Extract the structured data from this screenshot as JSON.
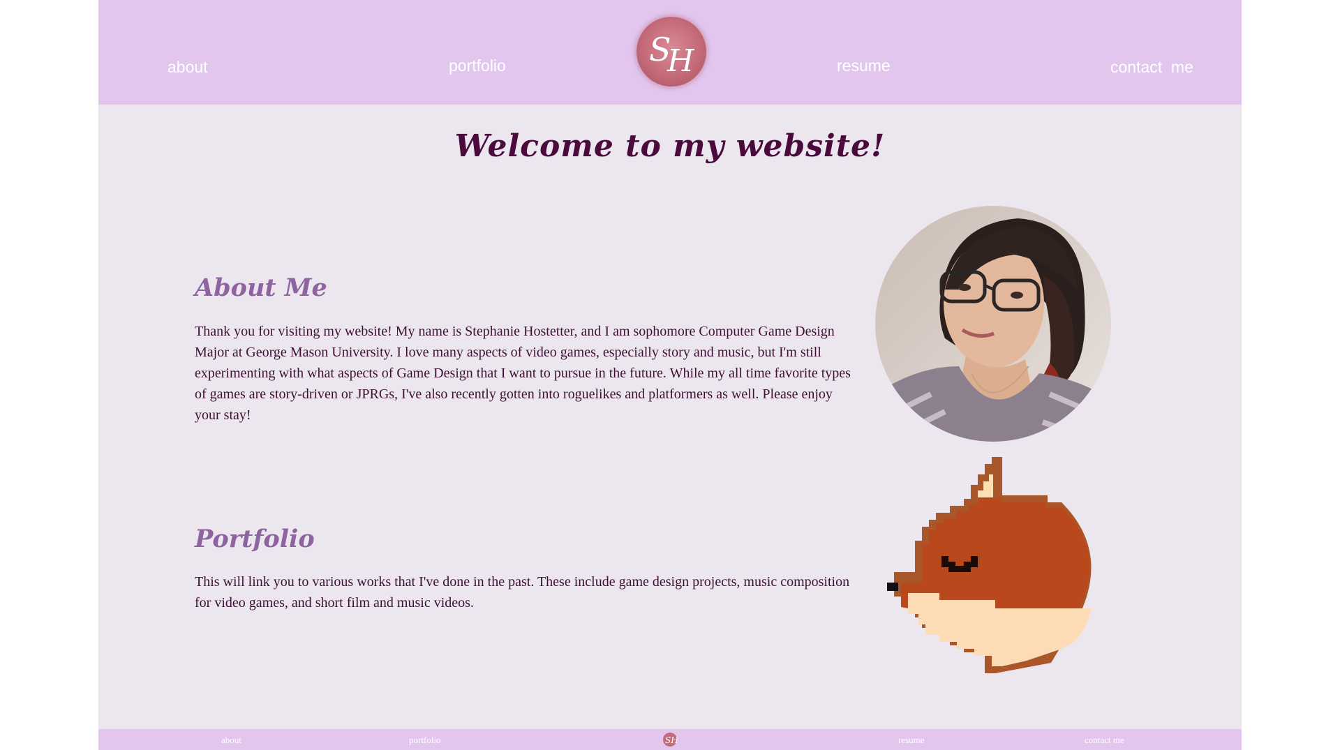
{
  "nav": {
    "about": "about",
    "portfolio": "portfolio",
    "resume": "resume",
    "contact": "contact  me",
    "logo_text": "SH"
  },
  "title": "Welcome to my website!",
  "about": {
    "heading": "About Me",
    "text": "Thank you for visiting my website! My name is Stephanie Hostetter, and I am sophomore Computer Game Design Major at George Mason University. I love many aspects of video games, especially story and music, but I'm still experimenting with what aspects of Game Design that I want to pursue in the future. While my all time favorite types of games are story-driven or JPRGs, I've also recently gotten into roguelikes and platformers as well. Please enjoy your stay!"
  },
  "portfolio": {
    "heading": "Portfolio",
    "text": "This will link you to various works that I've done in the past. These include game design projects, music composition for video games, and short film and music videos."
  },
  "footer": {
    "about": "about",
    "portfolio": "portfolio",
    "resume": "resume",
    "contact": "contact me"
  },
  "colors": {
    "header_bg": "#e2c6ee",
    "page_bg": "#ece6ef",
    "title": "#4a0a3c",
    "heading": "#8e64a0",
    "body_text": "#3e1035",
    "fox_orange": "#b94a1e",
    "fox_cream": "#fddcb5"
  },
  "icons": {
    "logo": "sh-monogram-logo",
    "portrait": "profile-photo",
    "fox": "pixel-fox-illustration"
  }
}
